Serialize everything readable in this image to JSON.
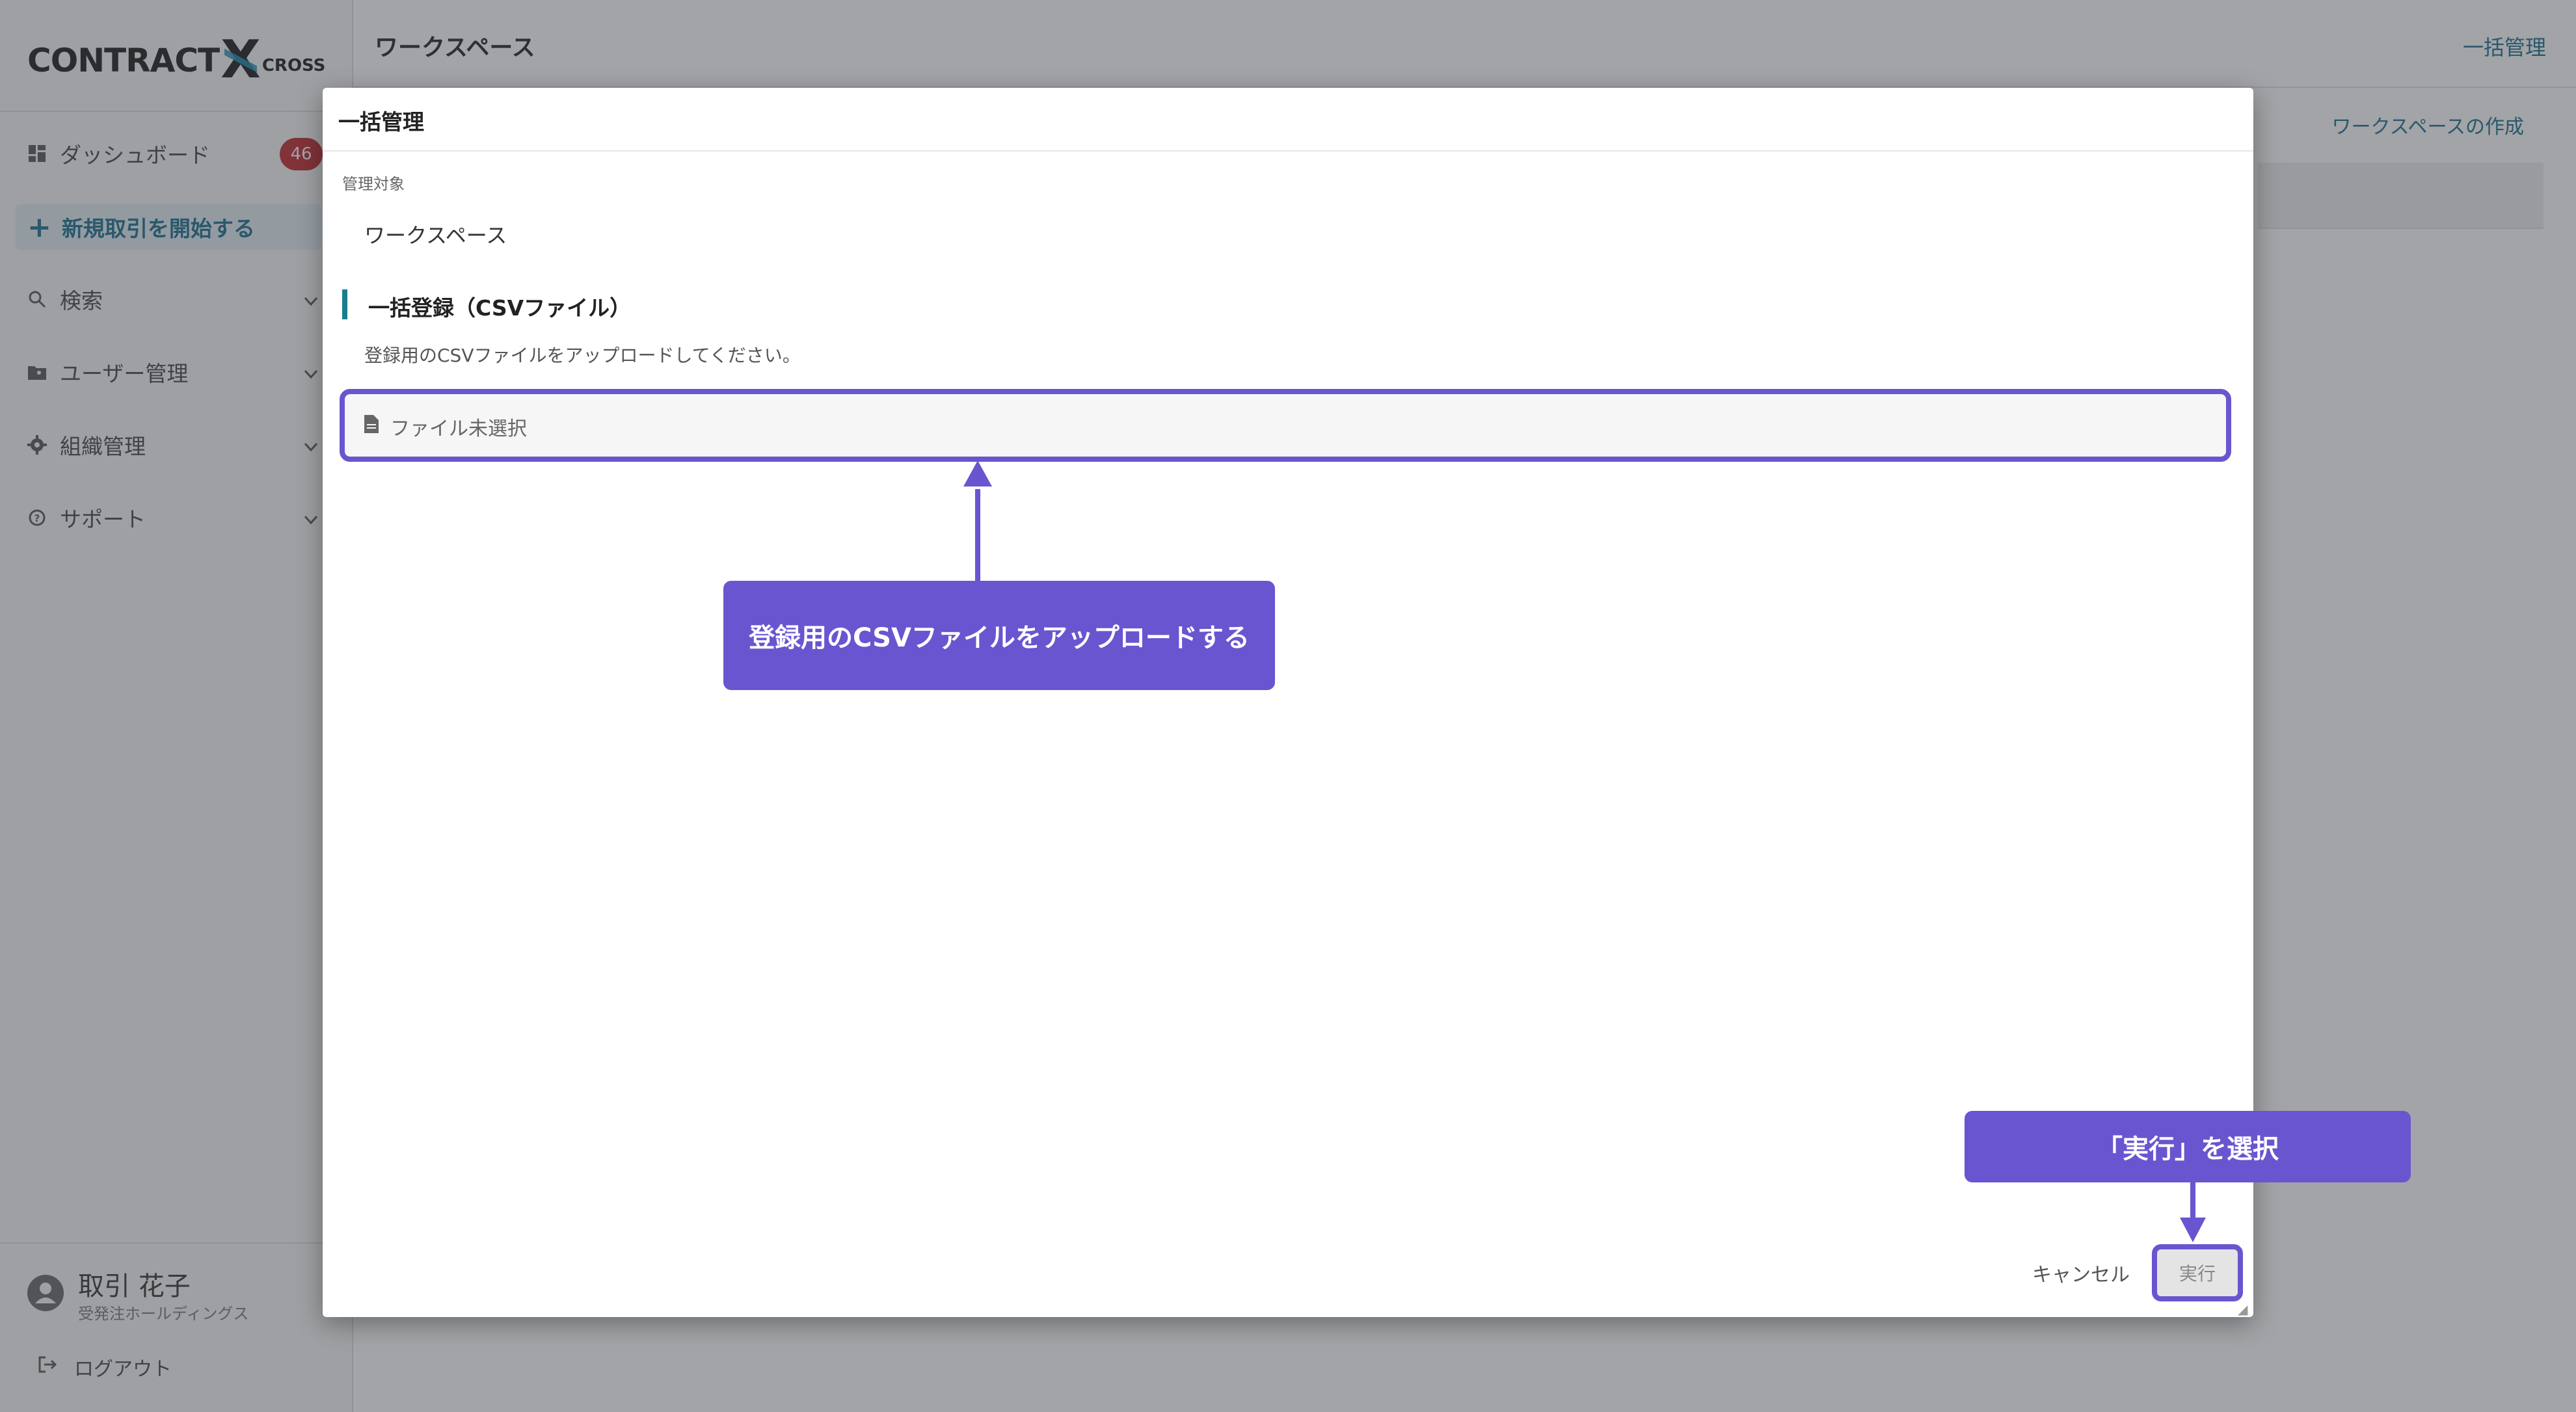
{
  "app": {
    "logo": "CONTRACT X CROSS",
    "logo_main": "CONTRACT",
    "logo_x": "X",
    "logo_cross": "CROSS"
  },
  "sidebar": {
    "items": [
      {
        "label": "ダッシュボード",
        "icon": "dashboard-icon",
        "badge": "46"
      },
      {
        "label": "新規取引を開始する",
        "icon": "plus-icon"
      },
      {
        "label": "検索",
        "icon": "search-icon"
      },
      {
        "label": "ユーザー管理",
        "icon": "folder-user-icon"
      },
      {
        "label": "組織管理",
        "icon": "gear-icon"
      },
      {
        "label": "サポート",
        "icon": "help-circle-icon"
      }
    ],
    "user": {
      "name": "取引 花子",
      "org": "受発注ホールディングス"
    },
    "logout_label": "ログアウト"
  },
  "header": {
    "title": "ワークスペース",
    "bulk_link": "一括管理",
    "create_link": "ワークスペースの作成"
  },
  "modal": {
    "title": "一括管理",
    "target_label": "管理対象",
    "target_value": "ワークスペース",
    "section_title": "一括登録（CSVファイル）",
    "section_desc": "登録用のCSVファイルをアップロードしてください。",
    "file_placeholder": "ファイル未選択",
    "cancel_label": "キャンセル",
    "run_label": "実行"
  },
  "annotations": {
    "upload_callout": "登録用のCSVファイルをアップロードする",
    "run_callout": "「実行」を選択"
  },
  "colors": {
    "accent": "#1a6d8f",
    "annotation": "#6a55d0",
    "badge": "#c0282d"
  }
}
